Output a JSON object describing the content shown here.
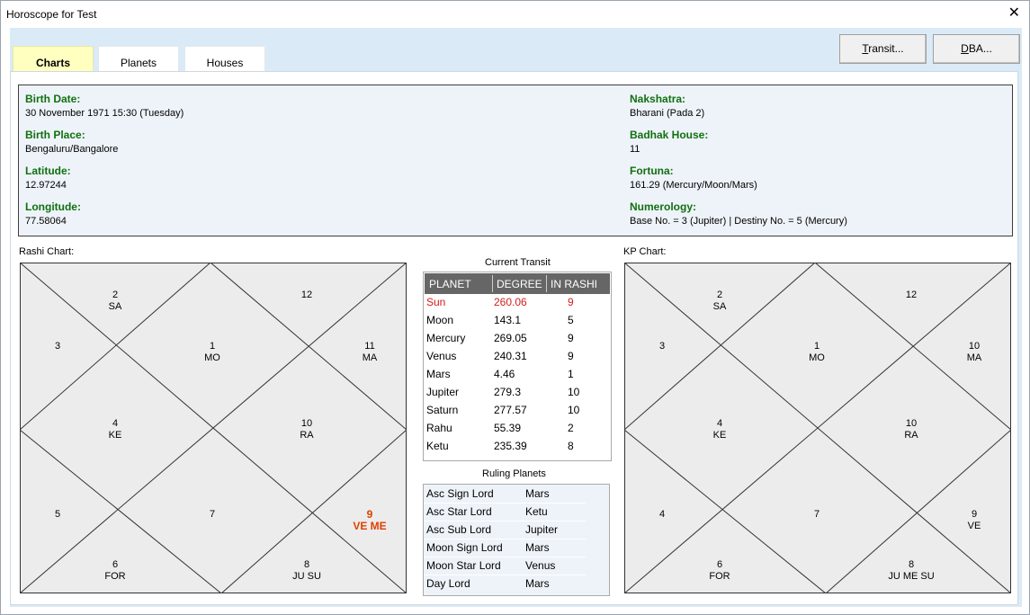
{
  "window": {
    "title": "Horoscope for Test",
    "close_glyph": "✕"
  },
  "tabs": [
    {
      "label": "Charts",
      "active": true
    },
    {
      "label": "Planets",
      "active": false
    },
    {
      "label": "Houses",
      "active": false
    }
  ],
  "buttons": {
    "transit_pre": "T",
    "transit_post": "ransit...",
    "dba_pre": "D",
    "dba_post": "BA..."
  },
  "info": {
    "birth_date": {
      "label": "Birth Date:",
      "value": "30 November 1971 15:30 (Tuesday)"
    },
    "birth_place": {
      "label": "Birth Place:",
      "value": "Bengaluru/Bangalore"
    },
    "latitude": {
      "label": "Latitude:",
      "value": "12.97244"
    },
    "longitude": {
      "label": "Longitude:",
      "value": "77.58064"
    },
    "nakshatra": {
      "label": "Nakshatra:",
      "value": "Bharani (Pada 2)"
    },
    "badhak_house": {
      "label": "Badhak House:",
      "value": "11"
    },
    "fortuna": {
      "label": "Fortuna:",
      "value": "161.29 (Mercury/Moon/Mars)"
    },
    "numerology": {
      "label": "Numerology:",
      "value": "Base No. = 3 (Jupiter)  |  Destiny No. = 5 (Mercury)"
    }
  },
  "rashi_chart": {
    "caption": "Rashi Chart:",
    "houses": [
      {
        "num": "2",
        "planets": "SA"
      },
      {
        "num": "12",
        "planets": ""
      },
      {
        "num": "3",
        "planets": ""
      },
      {
        "num": "1",
        "planets": "MO"
      },
      {
        "num": "11",
        "planets": "MA"
      },
      {
        "num": "4",
        "planets": "KE"
      },
      {
        "num": "10",
        "planets": "RA"
      },
      {
        "num": "5",
        "planets": ""
      },
      {
        "num": "7",
        "planets": ""
      },
      {
        "num": "9",
        "planets": "VE ME",
        "highlight": true
      },
      {
        "num": "6",
        "planets": "FOR"
      },
      {
        "num": "8",
        "planets": "JU SU"
      }
    ]
  },
  "kp_chart": {
    "caption": "KP Chart:",
    "houses": [
      {
        "num": "2",
        "planets": "SA"
      },
      {
        "num": "12",
        "planets": ""
      },
      {
        "num": "3",
        "planets": ""
      },
      {
        "num": "1",
        "planets": "MO"
      },
      {
        "num": "10",
        "planets": "MA"
      },
      {
        "num": "4",
        "planets": "KE"
      },
      {
        "num": "10",
        "planets": "RA"
      },
      {
        "num": "4",
        "planets": ""
      },
      {
        "num": "7",
        "planets": ""
      },
      {
        "num": "9",
        "planets": "VE"
      },
      {
        "num": "6",
        "planets": "FOR"
      },
      {
        "num": "8",
        "planets": "JU ME SU"
      }
    ]
  },
  "current_transit": {
    "title": "Current Transit",
    "headers": [
      "PLANET",
      "DEGREE",
      "IN RASHI"
    ],
    "rows": [
      {
        "planet": "Sun",
        "degree": "260.06",
        "rashi": "9",
        "highlight": true
      },
      {
        "planet": "Moon",
        "degree": "143.1",
        "rashi": "5"
      },
      {
        "planet": "Mercury",
        "degree": "269.05",
        "rashi": "9"
      },
      {
        "planet": "Venus",
        "degree": "240.31",
        "rashi": "9"
      },
      {
        "planet": "Mars",
        "degree": "4.46",
        "rashi": "1"
      },
      {
        "planet": "Jupiter",
        "degree": "279.3",
        "rashi": "10"
      },
      {
        "planet": "Saturn",
        "degree": "277.57",
        "rashi": "10"
      },
      {
        "planet": "Rahu",
        "degree": "55.39",
        "rashi": "2"
      },
      {
        "planet": "Ketu",
        "degree": "235.39",
        "rashi": "8"
      }
    ]
  },
  "ruling_planets": {
    "title": "Ruling Planets",
    "rows": [
      {
        "label": "Asc Sign Lord",
        "value": "Mars"
      },
      {
        "label": "Asc Star Lord",
        "value": "Ketu"
      },
      {
        "label": "Asc Sub Lord",
        "value": "Jupiter"
      },
      {
        "label": "Moon Sign Lord",
        "value": "Mars"
      },
      {
        "label": "Moon Star Lord",
        "value": "Venus"
      },
      {
        "label": "Day Lord",
        "value": "Mars"
      }
    ]
  }
}
